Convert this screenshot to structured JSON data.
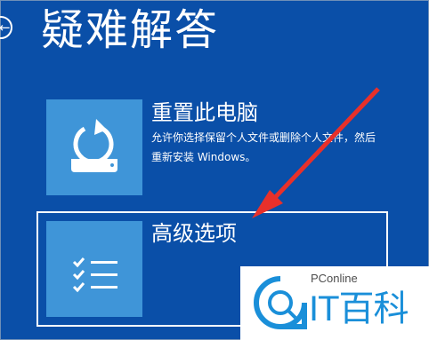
{
  "page": {
    "title": "疑难解答",
    "back_icon": "back-arrow-icon"
  },
  "options": {
    "reset": {
      "title": "重置此电脑",
      "description": "允许你选择保留个人文件或删除个人文件，然后重新安装 Windows。",
      "icon": "reset-pc-icon"
    },
    "advanced": {
      "title": "高级选项",
      "icon": "checklist-icon"
    }
  },
  "annotation": {
    "color": "#e8302a"
  },
  "watermark": {
    "small_text": "PConline",
    "big_text": "IT百科",
    "accent_color": "#1a8fd9"
  },
  "colors": {
    "background": "#0a4fa8",
    "tile": "#3f95d8"
  }
}
